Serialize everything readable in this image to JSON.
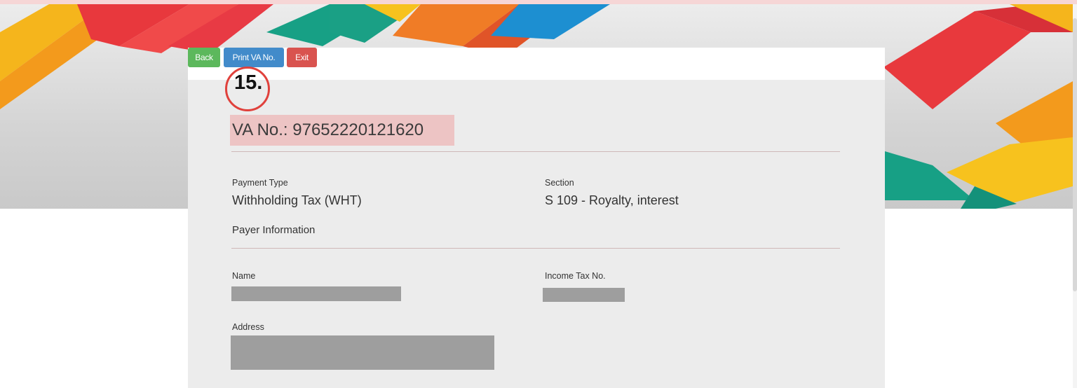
{
  "toolbar": {
    "back_label": "Back",
    "print_label": "Print VA No.",
    "exit_label": "Exit"
  },
  "annotation": {
    "step": "15."
  },
  "va": {
    "text": "VA No.: 97652220121620"
  },
  "payment": {
    "type_label": "Payment Type",
    "type_value": "Withholding Tax (WHT)",
    "section_label": "Section",
    "section_value": "S 109 - Royalty, interest"
  },
  "payer": {
    "heading": "Payer Information",
    "name_label": "Name",
    "tax_label": "Income Tax No.",
    "address_label": "Address"
  },
  "colors": {
    "back": "#5cb85c",
    "print": "#428bca",
    "exit": "#d9534f",
    "annotation": "#e0413c",
    "highlight": "#edc4c4"
  }
}
